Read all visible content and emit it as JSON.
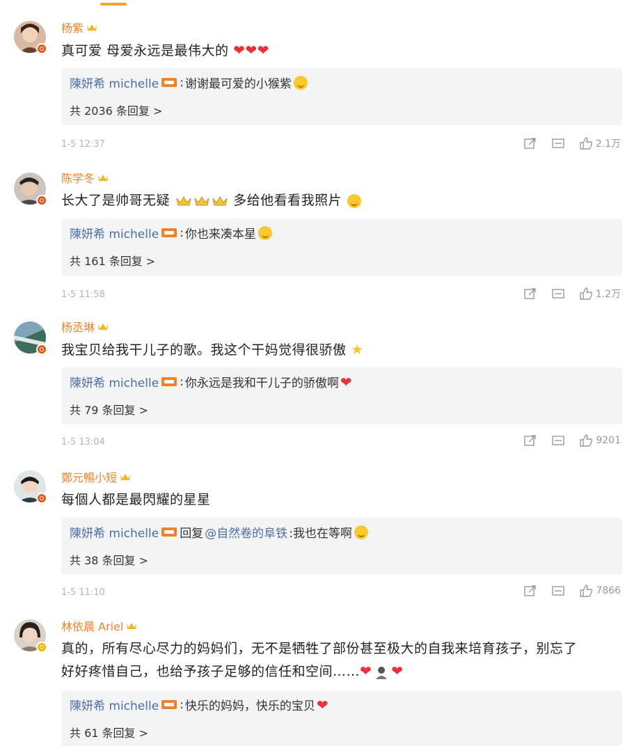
{
  "comments": [
    {
      "name": "杨紫",
      "text": "真可爱 母爱永远是最伟大的",
      "reply_user": "陳妍希 michelle",
      "reply_text": "谢谢最可爱的小猴紫",
      "reply_count": "共 2036 条回复 >",
      "time": "1-5 12:37",
      "likes": "2.1万",
      "badge_color": "#e8541e"
    },
    {
      "name": "陈学冬",
      "text_a": "长大了是帅哥无疑",
      "text_b": "多给他看看我照片",
      "reply_user": "陳妍希 michelle",
      "reply_text": "你也来凑本星",
      "reply_count": "共 161 条回复 >",
      "time": "1-5 11:58",
      "likes": "1.2万",
      "badge_color": "#e8541e"
    },
    {
      "name": "杨丞琳",
      "text": "我宝贝给我干儿子的歌。我这个干妈觉得很骄傲",
      "reply_user": "陳妍希 michelle",
      "reply_text": "你永远是我和干儿子的骄傲啊",
      "reply_count": "共 79 条回复 >",
      "time": "1-5 13:04",
      "likes": "9201",
      "badge_color": "#e8541e"
    },
    {
      "name": "鄭元暢小短",
      "text": "每個人都是最閃耀的星星",
      "reply_user": "陳妍希 michelle",
      "reply_prefix": "回复",
      "reply_mention": "@自然卷的阜铁",
      "reply_text": ":我也在等啊",
      "reply_count": "共 38 条回复 >",
      "time": "1-5 11:10",
      "likes": "7866",
      "badge_color": "#e8541e"
    },
    {
      "name": "林依晨 Ariel",
      "text_line1": "真的，所有尽心尽力的妈妈们，无不是牺牲了部份甚至极大的自我来培育孩子，别忘了",
      "text_line2": "好好疼惜自己，也给予孩子足够的信任和空间……",
      "reply_user": "陳妍希 michelle",
      "reply_text": "快乐的妈妈，快乐的宝贝",
      "reply_count": "共 61 条回复 >",
      "badge_color": "#f7b500"
    }
  ],
  "colors": {
    "name": "#f08228",
    "reply_user": "#4d6fa0",
    "reply_bg": "#f3f4f6",
    "time": "#b5b5b5",
    "heart": "#e8313a"
  },
  "icons": [
    "share-icon",
    "comment-icon",
    "like-icon",
    "crown-icon",
    "verified-icon"
  ]
}
